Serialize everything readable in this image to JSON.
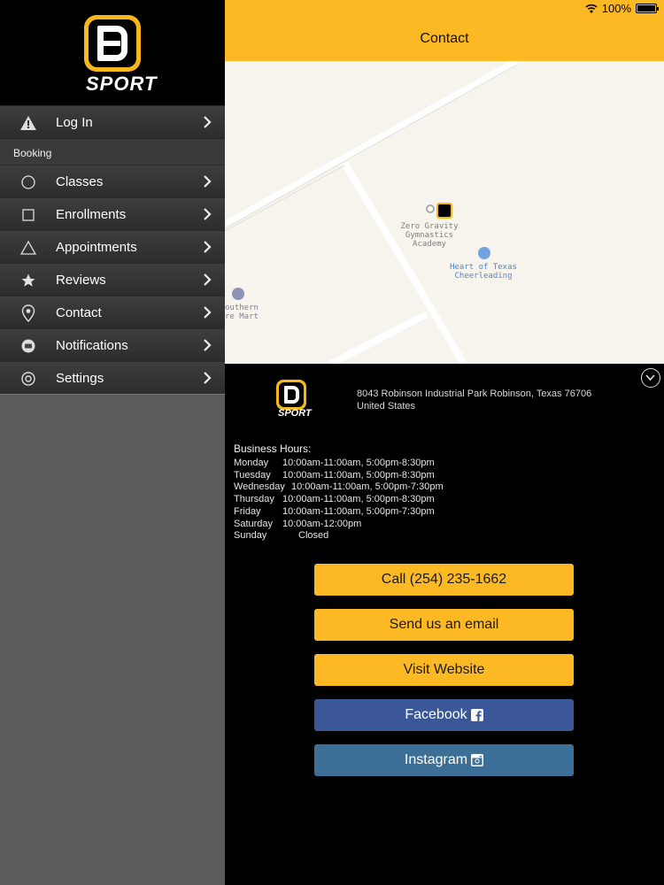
{
  "status": {
    "battery": "100%"
  },
  "brand": {
    "logo_text": "SPORT"
  },
  "sidebar": {
    "items": [
      {
        "label": "Log In",
        "icon": "warning-icon"
      },
      {
        "section": "Booking"
      },
      {
        "label": "Classes",
        "icon": "circle-icon"
      },
      {
        "label": "Enrollments",
        "icon": "square-icon"
      },
      {
        "label": "Appointments",
        "icon": "triangle-icon"
      },
      {
        "label": "Reviews",
        "icon": "star-icon"
      },
      {
        "label": "Contact",
        "icon": "location-pin-icon"
      },
      {
        "label": "Notifications",
        "icon": "chat-bubble-icon"
      },
      {
        "label": "Settings",
        "icon": "gear-icon"
      }
    ]
  },
  "header": {
    "title": "Contact"
  },
  "map": {
    "pin_label": "Zero Gravity\nGymnastics\nAcademy",
    "poi1": "Heart of Texas\nCheerleading",
    "poi2": "outhern\nre Mart"
  },
  "contact": {
    "address_line1": "8043 Robinson Industrial Park Robinson, Texas 76706",
    "address_line2": "United States",
    "hours_title": "Business Hours:",
    "hours": [
      {
        "day": "Monday",
        "time": "10:00am-11:00am, 5:00pm-8:30pm"
      },
      {
        "day": "Tuesday",
        "time": "10:00am-11:00am, 5:00pm-8:30pm"
      },
      {
        "day": "Wednesday",
        "time": "10:00am-11:00am, 5:00pm-7:30pm"
      },
      {
        "day": "Thursday",
        "time": "10:00am-11:00am, 5:00pm-8:30pm"
      },
      {
        "day": "Friday",
        "time": "10:00am-11:00am, 5:00pm-7:30pm"
      },
      {
        "day": "Saturday",
        "time": "10:00am-12:00pm"
      },
      {
        "day": "Sunday",
        "time": "Closed"
      }
    ],
    "buttons": {
      "call": "Call (254) 235-1662",
      "email": "Send us an email",
      "website": "Visit Website",
      "facebook": "Facebook",
      "instagram": "Instagram"
    }
  },
  "colors": {
    "accent": "#fdb924",
    "facebook": "#3b5797",
    "instagram": "#3b6f97"
  }
}
